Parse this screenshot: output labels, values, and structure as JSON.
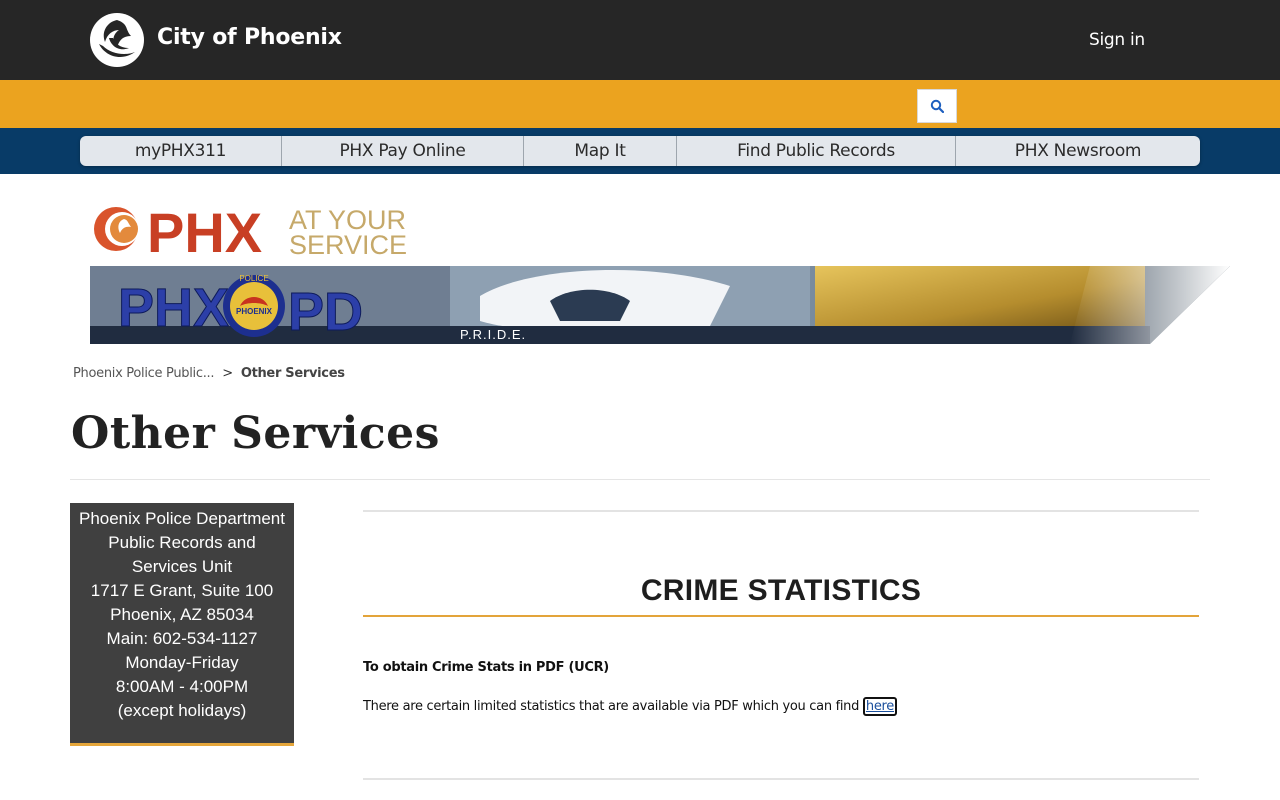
{
  "header": {
    "site_title": "City of Phoenix",
    "signin_label": "Sign in"
  },
  "search": {
    "icon": "search-icon"
  },
  "nav": {
    "items": [
      {
        "label": "myPHX311"
      },
      {
        "label": "PHX Pay Online"
      },
      {
        "label": "Map It"
      },
      {
        "label": "Find Public Records"
      },
      {
        "label": "PHX Newsroom"
      }
    ]
  },
  "banner": {
    "logo_text_main": "PHX",
    "logo_text_line1": "AT YOUR",
    "logo_text_line2": "SERVICE",
    "pd_left": "PHX",
    "pd_right": "PD",
    "badge_text": "PHOENIX",
    "badge_top": "POLICE",
    "pride": "P.R.I.D.E."
  },
  "breadcrumb": {
    "parent": "Phoenix Police Public...",
    "separator": ">",
    "current": "Other Services"
  },
  "page": {
    "title": "Other Services"
  },
  "infobox": {
    "lines": [
      "Phoenix Police Department",
      "Public Records and",
      "Services Unit",
      "1717 E Grant, Suite 100",
      "Phoenix, AZ 85034",
      "Main: 602-534-1127",
      "Monday-Friday",
      "8:00AM - 4:00PM",
      "(except holidays)"
    ]
  },
  "content": {
    "heading": "CRIME STATISTICS",
    "subheading": "To obtain Crime Stats in PDF (UCR)",
    "body": "There are certain limited statistics that are available via PDF which you can find ",
    "link_label": "here"
  },
  "colors": {
    "header_bg": "#262626",
    "gold": "#eba31f",
    "navy": "#083b67",
    "accent_rule": "#e3a43a"
  }
}
